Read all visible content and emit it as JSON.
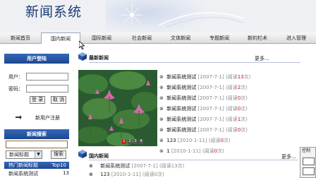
{
  "header": {
    "title": "新闻系统"
  },
  "nav": {
    "items": [
      {
        "label": "新闻首页",
        "active": false
      },
      {
        "label": "国内新闻",
        "active": true
      },
      {
        "label": "国际新闻",
        "active": false
      },
      {
        "label": "社会新闻",
        "active": false
      },
      {
        "label": "文体新闻",
        "active": false
      },
      {
        "label": "专题新闻",
        "active": false
      },
      {
        "label": "新的栏术",
        "active": false
      },
      {
        "label": "进入管理",
        "active": false
      }
    ]
  },
  "login": {
    "title": "用户登陆",
    "username_label": "用户：",
    "password_label": "密码：",
    "login_button": "登 录",
    "cancel_button": "取 消",
    "register_link": "新用户注册"
  },
  "search": {
    "title": "新闻搜索",
    "input_value": "",
    "select_value": "新闻标题",
    "search_button": "搜索"
  },
  "hot": {
    "title": "热门新闻标题",
    "top_label": "Top10",
    "items": [
      {
        "title": "新闻系统测试",
        "count": "13"
      }
    ]
  },
  "latest": {
    "title": "最新新闻",
    "more": "更多...",
    "pager": [
      "1",
      "2",
      "3",
      "4"
    ],
    "items": [
      {
        "title": "新闻系统测试",
        "date": "[2007-7-1]",
        "hits_prefix": "(阅读",
        "hits": "13",
        "hits_suffix": "次)"
      },
      {
        "title": "新闻系统测试",
        "date": "[2007-7-1]",
        "hits_prefix": "(阅读",
        "hits": "2",
        "hits_suffix": "次)"
      },
      {
        "title": "新闻系统测试",
        "date": "[2007-7-1]",
        "hits_prefix": "(阅读",
        "hits": "0",
        "hits_suffix": "次)"
      },
      {
        "title": "新闻系统测试",
        "date": "[2007-7-1]",
        "hits_prefix": "(阅读",
        "hits": "0",
        "hits_suffix": "次)"
      },
      {
        "title": "新闻系统测试",
        "date": "[2007-7-1]",
        "hits_prefix": "(阅读",
        "hits": "1",
        "hits_suffix": "次)"
      },
      {
        "title": "新闻系统测试",
        "date": "[2007-7-1]",
        "hits_prefix": "(阅读",
        "hits": "0",
        "hits_suffix": "次)"
      },
      {
        "title": "123",
        "date": "[2010-1-11]",
        "hits_prefix": "(阅读",
        "hits": "0",
        "hits_suffix": "次)"
      },
      {
        "title": "1",
        "date": "[2010-1-11]",
        "hits_prefix": "(阅读",
        "hits": "0",
        "hits_suffix": "次)"
      }
    ]
  },
  "domestic": {
    "title": "国内新闻",
    "more": "更多...",
    "items": [
      {
        "title": "新闻系统测试",
        "date": "[2007-7-1]",
        "hits": "(阅读13次)"
      },
      {
        "title": "123",
        "date": "[2010-1-11]",
        "hits": "(阅读0次)"
      }
    ]
  },
  "panel": {
    "title": "控制"
  },
  "colors": {
    "nav_border": "#9aa7c0",
    "box_blue": "#1d478f",
    "highlight_red": "#c01010"
  }
}
